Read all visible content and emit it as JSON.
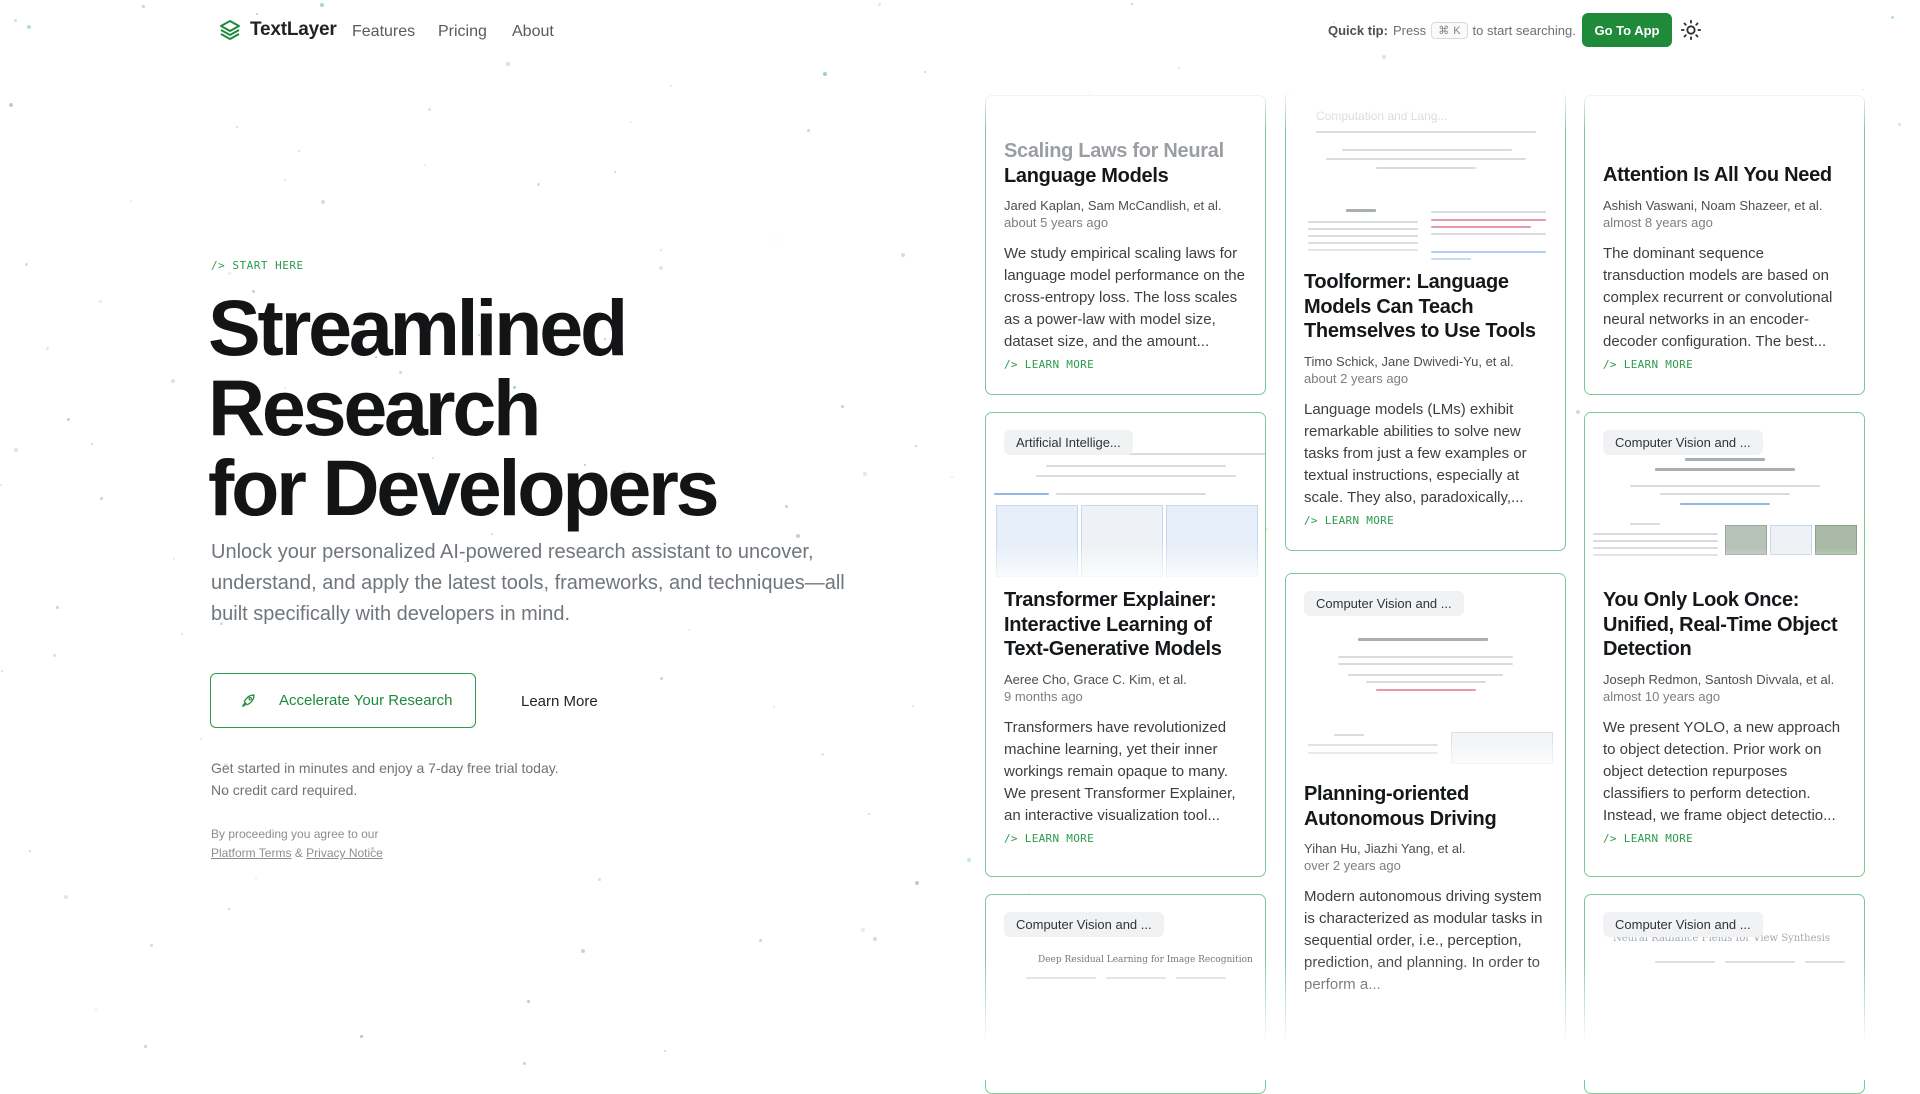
{
  "nav": {
    "brand": "TextLayer",
    "links": [
      "Features",
      "Pricing",
      "About"
    ],
    "quick_tip_lead": "Quick tip:",
    "quick_tip_press": "Press",
    "shortcut_key": "K",
    "quick_tip_tail": "to start searching.",
    "cta": "Go To App"
  },
  "hero": {
    "eyebrow": "/> START HERE",
    "headline": [
      "Streamlined",
      "Research",
      "for Developers"
    ],
    "subheading": "Unlock your personalized AI-powered research assistant to uncover, understand, and apply the latest tools, frameworks, and techniques—all built specifically with developers in mind.",
    "primary_cta": "Accelerate Your Research",
    "secondary_cta": "Learn More",
    "trial_line1": "Get started in minutes and enjoy a 7-day free trial today.",
    "trial_line2": "No credit card required.",
    "legal_prefix": "By proceeding you agree to our",
    "terms_link": "Platform Terms",
    "legal_and": "&",
    "privacy_link": "Privacy Notice"
  },
  "learn_more_label": "/> LEARN MORE",
  "papers": [
    {
      "category": "",
      "thumb_text": "",
      "title": "Scaling Laws for Neural Language Models",
      "authors": "Jared Kaplan, Sam McCandlish, et al.",
      "date": "about 5 years ago",
      "abstract": "We study empirical scaling laws for language model performance on the cross-entropy loss. The loss scales as a power-law with model size, dataset size, and the amount..."
    },
    {
      "category": "",
      "thumb_text": "Computation and Lang...",
      "title": "Toolformer: Language Models Can Teach Themselves to Use Tools",
      "authors": "Timo Schick, Jane Dwivedi-Yu, et al.",
      "date": "about 2 years ago",
      "abstract": "Language models (LMs) exhibit remarkable abilities to solve new tasks from just a few examples or textual instructions, especially at scale. They also, paradoxically,..."
    },
    {
      "category": "",
      "thumb_text": "",
      "title": "Attention Is All You Need",
      "authors": "Ashish Vaswani, Noam Shazeer, et al.",
      "date": "almost 8 years ago",
      "abstract": "The dominant sequence transduction models are based on complex recurrent or convolutional neural networks in an encoder-decoder configuration. The best..."
    },
    {
      "category": "Artificial Intellige...",
      "thumb_text": "",
      "title": "Transformer Explainer: Interactive Learning of Text-Generative Models",
      "authors": "Aeree Cho, Grace C. Kim, et al.",
      "date": "9 months ago",
      "abstract": "Transformers have revolutionized machine learning, yet their inner workings remain opaque to many. We present Transformer Explainer, an interactive visualization tool..."
    },
    {
      "category": "Computer Vision and ...",
      "thumb_text": "",
      "title": "Planning-oriented Autonomous Driving",
      "authors": "Yihan Hu, Jiazhi Yang, et al.",
      "date": "over 2 years ago",
      "abstract": "Modern autonomous driving system is characterized as modular tasks in sequential order, i.e., perception, prediction, and planning. In order to perform a..."
    },
    {
      "category": "Computer Vision and ...",
      "thumb_text": "",
      "title": "You Only Look Once: Unified, Real-Time Object Detection",
      "authors": "Joseph Redmon, Santosh Divvala, et al.",
      "date": "almost 10 years ago",
      "abstract": "We present YOLO, a new approach to object detection. Prior work on object detection repurposes classifiers to perform detection. Instead, we frame object detectio..."
    },
    {
      "category": "Computer Vision and ...",
      "thumb_text": "Deep Residual Learning for Image Recognition",
      "title": "",
      "authors": "",
      "date": "",
      "abstract": ""
    },
    {
      "category": "Computer Vision and ...",
      "thumb_text": "Neural Radiance Fields for View Synthesis",
      "title": "",
      "authors": "",
      "date": "",
      "abstract": ""
    }
  ],
  "colors": {
    "brand_green": "#1f8a3a",
    "accent_green": "#2e9a4e",
    "card_border": "#7cc795"
  },
  "icons": [
    "textlayer-logo-icon",
    "command-key-icon",
    "sun-icon",
    "rocket-icon"
  ]
}
